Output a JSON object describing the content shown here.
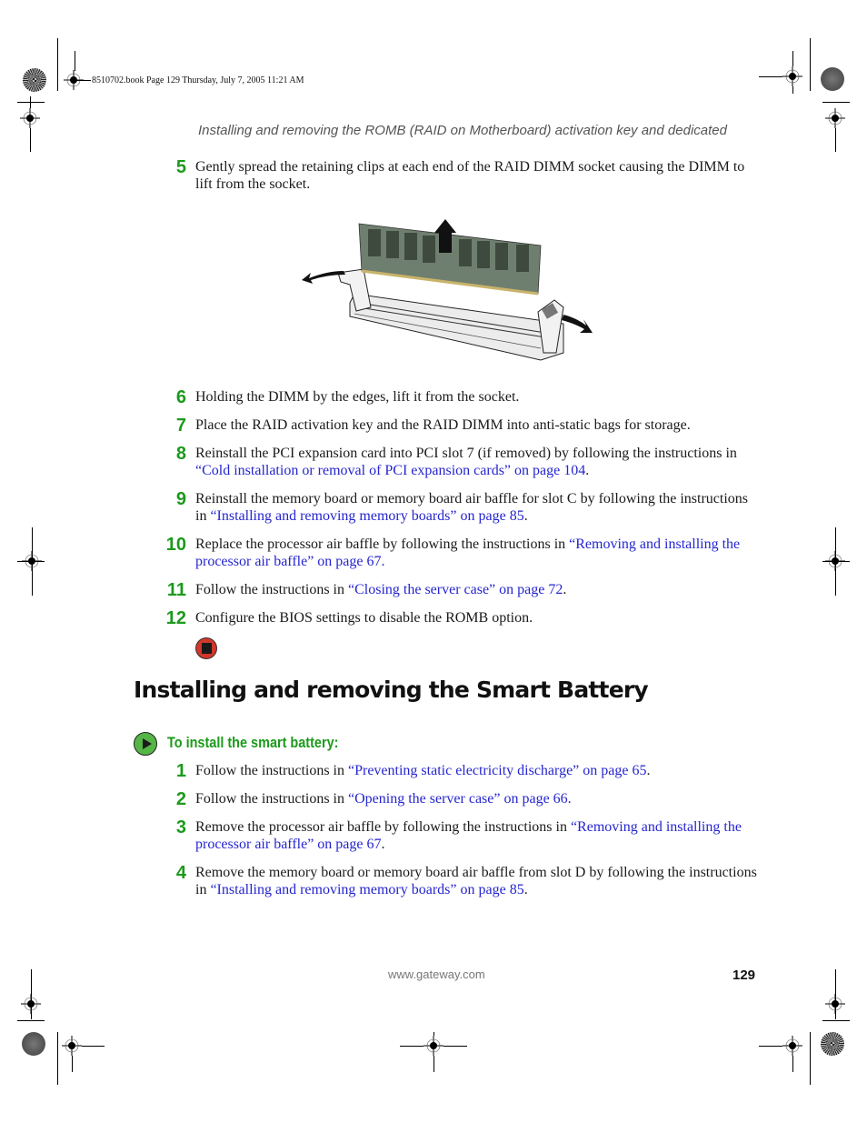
{
  "slug": "8510702.book  Page 129  Thursday, July 7, 2005  11:21 AM",
  "running_head": "Installing and removing the ROMB (RAID on Motherboard) activation key and dedicated",
  "steps_part1": [
    {
      "num": "5",
      "text": "Gently spread the retaining clips at each end of the RAID DIMM socket causing the DIMM to lift from the socket.",
      "link": "",
      "after": ""
    },
    {
      "num": "6",
      "text": "Holding the DIMM by the edges, lift it from the socket.",
      "link": "",
      "after": ""
    },
    {
      "num": "7",
      "text": "Place the RAID activation key and the RAID DIMM into anti-static bags for storage.",
      "link": "",
      "after": ""
    },
    {
      "num": "8",
      "text": "Reinstall the PCI expansion card into PCI slot 7 (if removed) by following the instructions in ",
      "link": "“Cold installation or removal of PCI expansion cards” on page 104",
      "after": "."
    },
    {
      "num": "9",
      "text": "Reinstall the memory board or memory board air baffle for slot C by following the instructions in ",
      "link": "“Installing and removing memory boards” on page 85",
      "after": "."
    },
    {
      "num": "10",
      "text": "Replace the processor air baffle by following the instructions in ",
      "link": "“Removing and installing the processor air baffle” on page 67.",
      "after": ""
    },
    {
      "num": "11",
      "text": "Follow the instructions in ",
      "link": "“Closing the server case” on page 72",
      "after": "."
    },
    {
      "num": "12",
      "text": "Configure the BIOS settings to disable the ROMB option.",
      "link": "",
      "after": ""
    }
  ],
  "figure": {
    "alt": "DIMM being lifted from RAID DIMM socket with retaining clips spread"
  },
  "icons": {
    "stop": "stop-icon",
    "go": "play-icon"
  },
  "section_title": "Installing and removing the Smart Battery",
  "procedure_heading": "To install the smart battery:",
  "steps_part2": [
    {
      "num": "1",
      "text": "Follow the instructions in ",
      "link": "“Preventing static electricity discharge” on page 65",
      "after": "."
    },
    {
      "num": "2",
      "text": "Follow the instructions in ",
      "link": "“Opening the server case” on page 66.",
      "after": ""
    },
    {
      "num": "3",
      "text": "Remove the processor air baffle by following the instructions in ",
      "link": "“Removing and installing the processor air baffle” on page 67",
      "after": "."
    },
    {
      "num": "4",
      "text": "Remove the memory board or memory board air baffle from slot D by following the instructions in ",
      "link": "“Installing and removing memory boards” on page 85",
      "after": "."
    }
  ],
  "footer": {
    "url": "www.gateway.com",
    "page_number": "129"
  },
  "colors": {
    "step_number": "#1b9a1b",
    "link": "#2525d0",
    "stop": "#d1372a",
    "go": "#55b547"
  }
}
